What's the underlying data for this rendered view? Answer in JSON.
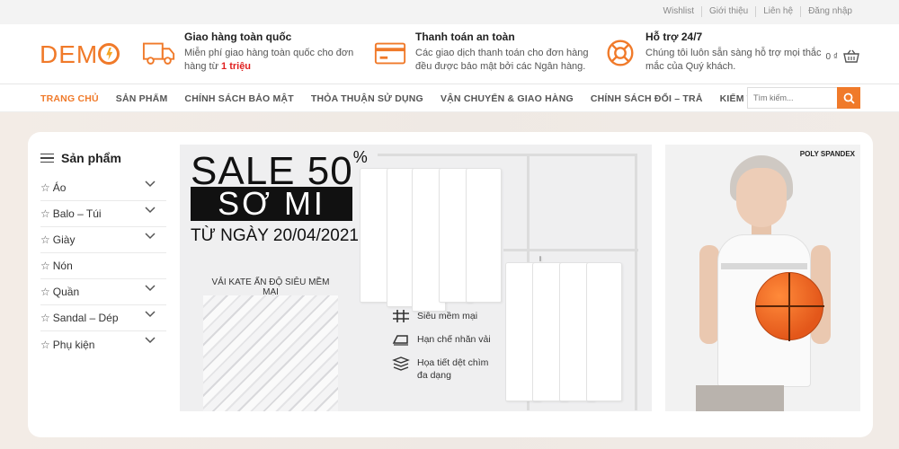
{
  "topbar": {
    "links": [
      "Wishlist",
      "Giới thiệu",
      "Liên hệ",
      "Đăng nhập"
    ]
  },
  "header": {
    "logo": "DEMO",
    "features": [
      {
        "icon": "truck-icon",
        "title": "Giao hàng toàn quốc",
        "text": "Miễn phí giao hàng toàn quốc cho đơn hàng từ ",
        "highlight": "1 triệu"
      },
      {
        "icon": "credit-card-icon",
        "title": "Thanh toán an toàn",
        "text": "Các giao dịch thanh toán cho đơn hàng đều được bảo mật bởi các Ngân hàng.",
        "highlight": ""
      },
      {
        "icon": "lifebuoy-icon",
        "title": "Hỗ trợ 24/7",
        "text": "Chúng tôi luôn sẵn sàng hỗ trợ mọi thắc mắc của Quý khách.",
        "highlight": ""
      }
    ],
    "cart_total": "0 ₫"
  },
  "nav": {
    "items": [
      "TRANG CHỦ",
      "SẢN PHẨM",
      "CHÍNH SÁCH BẢO MẬT",
      "THỎA THUẬN SỬ DỤNG",
      "VẬN CHUYỂN & GIAO HÀNG",
      "CHÍNH SÁCH ĐỔI – TRẢ",
      "KIỂM TRA ĐƠN HÀNG"
    ],
    "active": "TRANG CHỦ",
    "search_placeholder": "Tìm kiếm..."
  },
  "sidebar": {
    "title": "Sản phẩm",
    "items": [
      {
        "label": "Áo",
        "expandable": true
      },
      {
        "label": "Balo – Túi",
        "expandable": true
      },
      {
        "label": "Giày",
        "expandable": true
      },
      {
        "label": "Nón",
        "expandable": false
      },
      {
        "label": "Quần",
        "expandable": true
      },
      {
        "label": "Sandal – Dép",
        "expandable": true
      },
      {
        "label": "Phụ kiện",
        "expandable": true
      }
    ]
  },
  "banner": {
    "sale": "SALE 50",
    "percent": "%",
    "product": "SƠ MI",
    "date": "TỪ NGÀY 20/04/2021",
    "fabric_label": "VẢI KATE ẤN ĐỘ SIÊU MỀM MẠI",
    "features": [
      "Siêu mềm mại",
      "Hạn chế nhăn vải",
      "Họa tiết dệt chìm đa dạng"
    ]
  },
  "promo": {
    "tag": "POLY SPANDEX"
  },
  "colors": {
    "accent": "#f07a2a",
    "highlight": "#e02020"
  }
}
